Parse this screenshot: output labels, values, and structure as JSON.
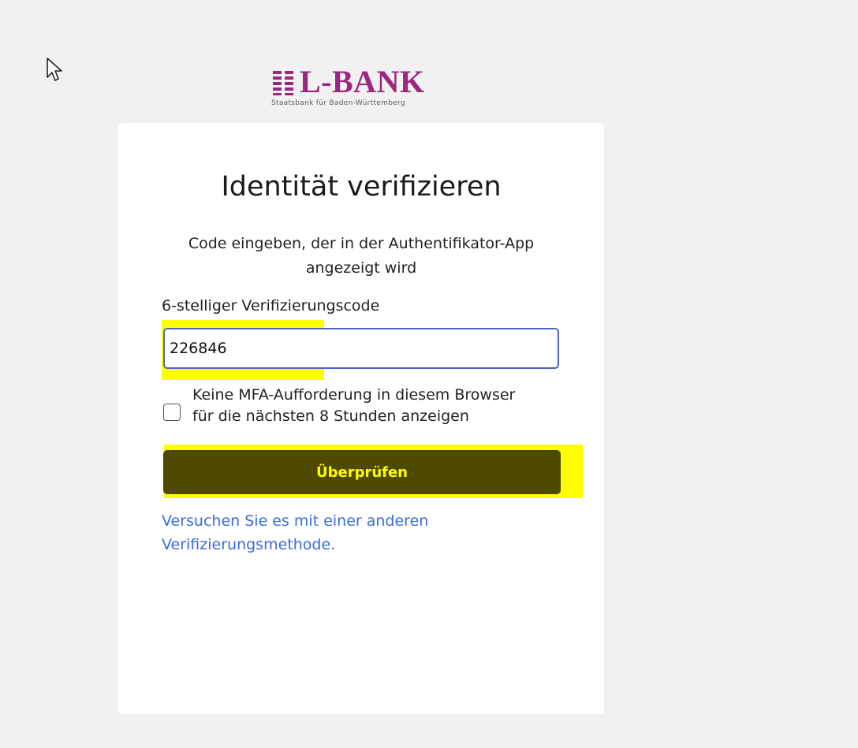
{
  "logo": {
    "name": "L-BANK",
    "tagline": "Staatsbank für Baden-Württemberg",
    "brand_color": "#9b2781"
  },
  "card": {
    "title": "Identität verifizieren",
    "subtitle": "Code eingeben, der in der Authentifikator-App angezeigt wird",
    "code_label": "6-stelliger Verifizierungscode",
    "code_value": "226846",
    "checkbox_label": "Keine MFA-Aufforderung in diesem Browser für die nächsten 8 Stunden anzeigen",
    "checkbox_checked": false,
    "verify_button": "Überprüfen",
    "alt_method_link": "Versuchen Sie es mit einer anderen Verifizierungsmethode."
  },
  "colors": {
    "background": "#f1f1f1",
    "highlight": "#ffff00",
    "button_bg": "#4e4a00",
    "link": "#3a6be0",
    "input_border": "#4a64c8"
  },
  "icons": {
    "cursor": "mouse-pointer-icon",
    "logo_mark": "coat-of-arms-icon"
  }
}
